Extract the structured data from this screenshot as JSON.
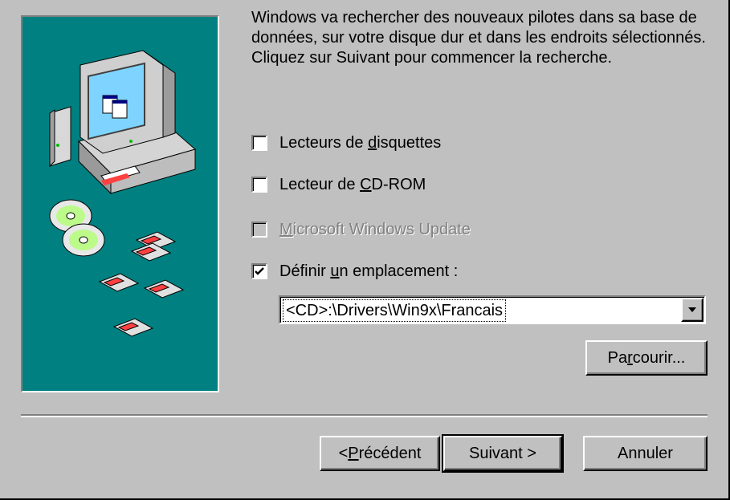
{
  "intro_text": "Windows va rechercher des nouveaux pilotes dans sa base de données, sur votre disque dur et dans les endroits sélectionnés. Cliquez sur Suivant pour commencer la recherche.",
  "options": [
    {
      "pre": "Lecteurs de ",
      "key": "d",
      "post": "isquettes",
      "checked": false,
      "disabled": false
    },
    {
      "pre": "Lecteur de ",
      "key": "C",
      "post": "D-ROM",
      "checked": false,
      "disabled": false
    },
    {
      "pre": "",
      "key": "M",
      "post": "icrosoft Windows Update",
      "checked": false,
      "disabled": true
    },
    {
      "pre": "Définir ",
      "key": "u",
      "post": "n emplacement :",
      "checked": true,
      "disabled": false
    }
  ],
  "location": {
    "value": "<CD>:\\Drivers\\Win9x\\Francais"
  },
  "buttons": {
    "browse": {
      "pre": "Pa",
      "key": "r",
      "post": "courir..."
    },
    "back": {
      "pre": "< ",
      "key": "P",
      "post": "récédent"
    },
    "next": {
      "label": "Suivant >"
    },
    "cancel": {
      "label": "Annuler"
    }
  },
  "colors": {
    "face": "#c0c0c0",
    "art_background": "#008080"
  }
}
